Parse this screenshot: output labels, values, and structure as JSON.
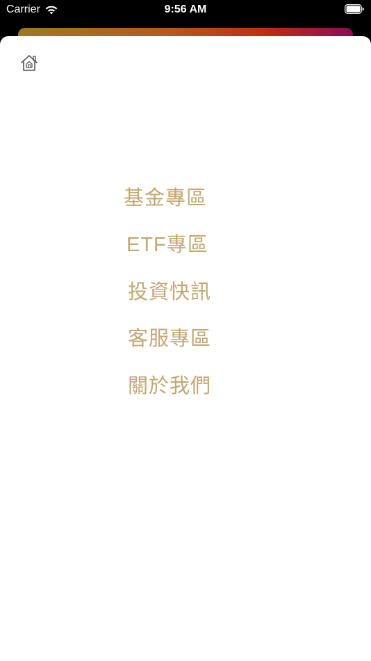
{
  "status_bar": {
    "carrier": "Carrier",
    "time": "9:56 AM"
  },
  "header": {
    "home_icon": "home-icon"
  },
  "menu": {
    "items": [
      {
        "label": "基金專區"
      },
      {
        "label": "ETF專區"
      },
      {
        "label": "投資快訊"
      },
      {
        "label": "客服專區"
      },
      {
        "label": "關於我們"
      }
    ]
  },
  "colors": {
    "menu_text": "#c2a874",
    "sheet_background": "#ffffff",
    "status_bar_background": "#000000"
  }
}
